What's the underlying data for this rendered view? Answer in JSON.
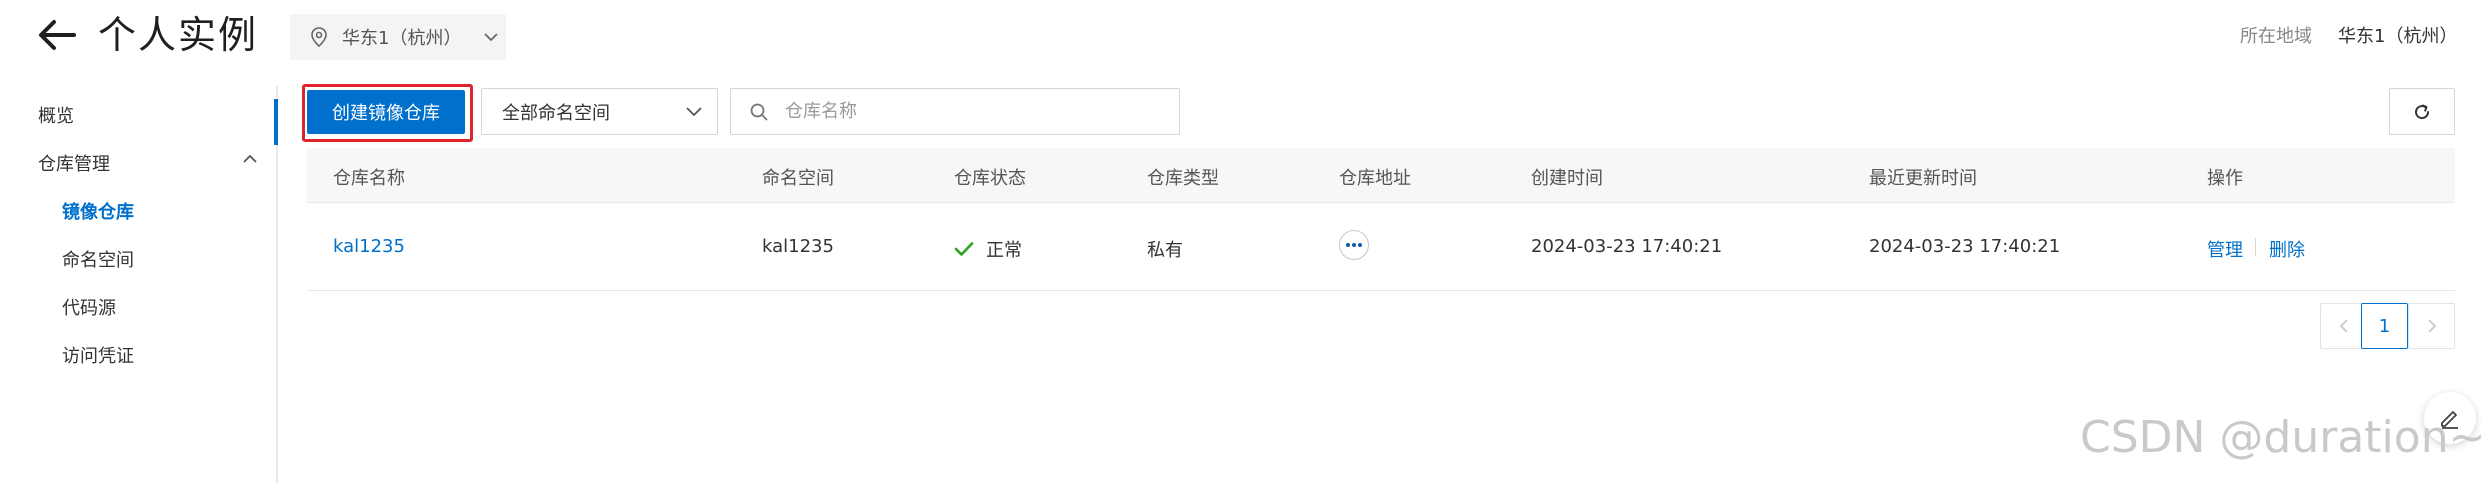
{
  "header": {
    "title": "个人实例",
    "region_selector": "华东1（杭州）",
    "region_label": "所在地域",
    "region_value": "华东1（杭州）"
  },
  "sidebar": {
    "items": [
      {
        "label": "概览"
      },
      {
        "label": "仓库管理"
      },
      {
        "label": "镜像仓库",
        "active": true
      },
      {
        "label": "命名空间"
      },
      {
        "label": "代码源"
      },
      {
        "label": "访问凭证"
      }
    ]
  },
  "toolbar": {
    "create_label": "创建镜像仓库",
    "namespace_select": "全部命名空间",
    "search_placeholder": "仓库名称"
  },
  "table": {
    "columns": [
      "仓库名称",
      "命名空间",
      "仓库状态",
      "仓库类型",
      "仓库地址",
      "创建时间",
      "最近更新时间",
      "操作"
    ],
    "rows": [
      {
        "name": "kal1235",
        "namespace": "kal1235",
        "status": "正常",
        "type": "私有",
        "created": "2024-03-23 17:40:21",
        "updated": "2024-03-23 17:40:21",
        "actions": [
          "管理",
          "删除"
        ]
      }
    ]
  },
  "pagination": {
    "current": "1"
  },
  "watermark": "CSDN @duration~",
  "colors": {
    "accent": "#0070cc",
    "highlight": "#e0242b",
    "success": "#2ea121"
  },
  "icons": [
    "back-arrow-icon",
    "location-pin-icon",
    "chevron-down-icon",
    "chevron-up-icon",
    "search-icon",
    "refresh-icon",
    "check-icon",
    "more-icon",
    "chevron-left-icon",
    "chevron-right-icon",
    "edit-icon"
  ]
}
